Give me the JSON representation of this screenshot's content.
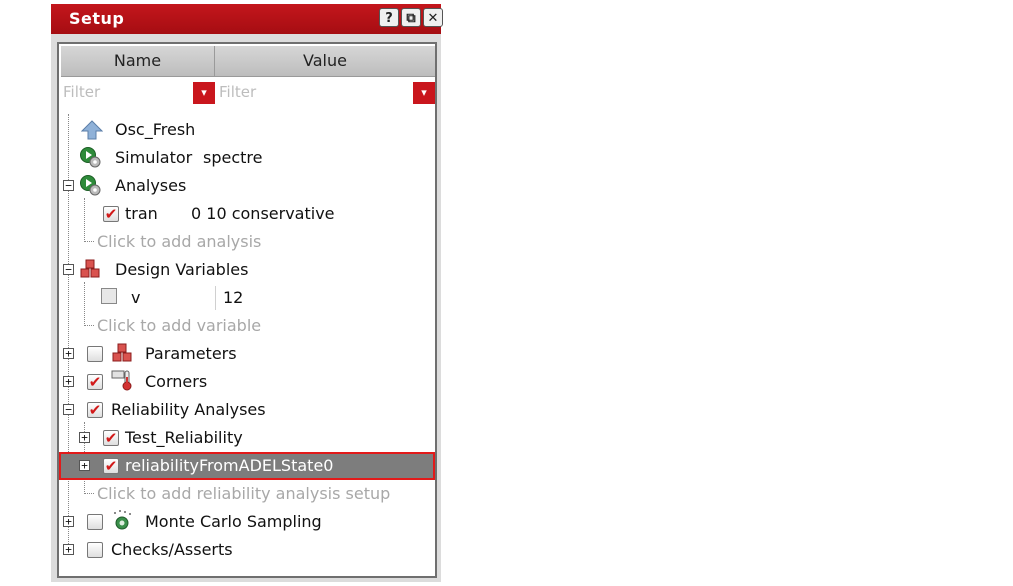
{
  "panel": {
    "title": "Setup",
    "buttons": {
      "help": "?",
      "float": "⧉",
      "close": "✕"
    }
  },
  "columns": {
    "name": "Name",
    "value": "Value"
  },
  "filters": {
    "name_placeholder": "Filter",
    "value_placeholder": "Filter",
    "dropdown_glyph": "▾"
  },
  "tree": {
    "osc_fresh": {
      "label": "Osc_Fresh"
    },
    "simulator": {
      "label": "Simulator",
      "value": "spectre"
    },
    "analyses": {
      "label": "Analyses",
      "expanded": true
    },
    "tran": {
      "label": "tran",
      "value": "0 10 conservative",
      "checked": true
    },
    "add_analysis": {
      "label": "Click to add analysis"
    },
    "design_variables": {
      "label": "Design Variables",
      "expanded": true
    },
    "var_v": {
      "label": "v",
      "value": "12"
    },
    "add_variable": {
      "label": "Click to add variable"
    },
    "parameters": {
      "label": "Parameters",
      "checked": false
    },
    "corners": {
      "label": "Corners",
      "checked": true
    },
    "reliability_analyses": {
      "label": "Reliability Analyses",
      "checked": true
    },
    "test_reliability": {
      "label": "Test_Reliability",
      "checked": true
    },
    "reliability_from_adel": {
      "label": "reliabilityFromADELState0",
      "checked": true,
      "selected": true
    },
    "add_reliability": {
      "label": "Click to add reliability analysis setup"
    },
    "monte_carlo": {
      "label": "Monte Carlo Sampling",
      "checked": false
    },
    "checks_asserts": {
      "label": "Checks/Asserts",
      "checked": false
    }
  },
  "glyphs": {
    "check": "✔",
    "plus": "+",
    "minus": "−"
  },
  "colors": {
    "accent": "#c4161c",
    "selected_bg": "#7d7d7d",
    "selected_outline": "#e21a1a",
    "hint_text": "#a8a8a8"
  }
}
